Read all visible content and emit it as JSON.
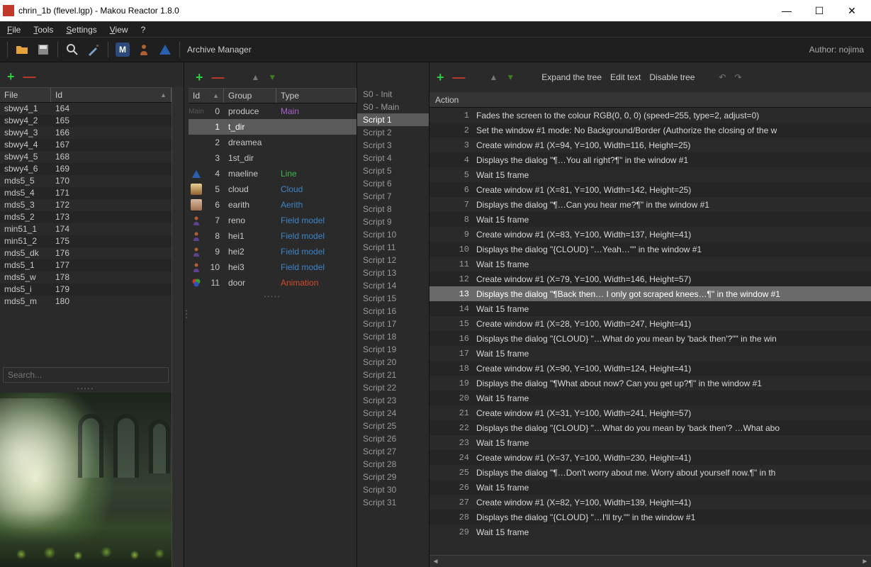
{
  "window": {
    "title": "chrin_1b (flevel.lgp) - Makou Reactor 1.8.0"
  },
  "menu": {
    "file": "File",
    "tools": "Tools",
    "settings": "Settings",
    "view": "View",
    "help": "?"
  },
  "toolbar": {
    "archive_manager": "Archive Manager",
    "author_label": "Author: nojima"
  },
  "actions_toolbar": {
    "expand": "Expand the tree",
    "edit": "Edit text",
    "disable": "Disable tree"
  },
  "files": {
    "header_file": "File",
    "header_id": "Id",
    "search_placeholder": "Search...",
    "rows": [
      {
        "file": "sbwy4_1",
        "id": "164"
      },
      {
        "file": "sbwy4_2",
        "id": "165"
      },
      {
        "file": "sbwy4_3",
        "id": "166"
      },
      {
        "file": "sbwy4_4",
        "id": "167"
      },
      {
        "file": "sbwy4_5",
        "id": "168"
      },
      {
        "file": "sbwy4_6",
        "id": "169"
      },
      {
        "file": "mds5_5",
        "id": "170"
      },
      {
        "file": "mds5_4",
        "id": "171"
      },
      {
        "file": "mds5_3",
        "id": "172"
      },
      {
        "file": "mds5_2",
        "id": "173"
      },
      {
        "file": "min51_1",
        "id": "174"
      },
      {
        "file": "min51_2",
        "id": "175"
      },
      {
        "file": "mds5_dk",
        "id": "176"
      },
      {
        "file": "mds5_1",
        "id": "177"
      },
      {
        "file": "mds5_w",
        "id": "178"
      },
      {
        "file": "mds5_i",
        "id": "179"
      },
      {
        "file": "mds5_m",
        "id": "180"
      }
    ]
  },
  "groups": {
    "header_id": "Id",
    "header_group": "Group",
    "header_type": "Type",
    "rows": [
      {
        "id": "0",
        "group": "produce",
        "type": "Main",
        "tclass": "tMain",
        "icon": "main",
        "sel": false
      },
      {
        "id": "1",
        "group": "t_dir",
        "type": "",
        "tclass": "",
        "icon": "",
        "sel": true
      },
      {
        "id": "2",
        "group": "dreamea",
        "type": "",
        "tclass": "",
        "icon": "",
        "sel": false
      },
      {
        "id": "3",
        "group": "1st_dir",
        "type": "",
        "tclass": "",
        "icon": "",
        "sel": false
      },
      {
        "id": "4",
        "group": "maeline",
        "type": "Line",
        "tclass": "tLine",
        "icon": "tri",
        "sel": false
      },
      {
        "id": "5",
        "group": "cloud",
        "type": "Cloud",
        "tclass": "tCloud",
        "icon": "av1",
        "sel": false
      },
      {
        "id": "6",
        "group": "earith",
        "type": "Aerith",
        "tclass": "tAerith",
        "icon": "av2",
        "sel": false
      },
      {
        "id": "7",
        "group": "reno",
        "type": "Field model",
        "tclass": "tFieldModel",
        "icon": "fm",
        "sel": false
      },
      {
        "id": "8",
        "group": "hei1",
        "type": "Field model",
        "tclass": "tFieldModel",
        "icon": "fm",
        "sel": false
      },
      {
        "id": "9",
        "group": "hei2",
        "type": "Field model",
        "tclass": "tFieldModel",
        "icon": "fm",
        "sel": false
      },
      {
        "id": "10",
        "group": "hei3",
        "type": "Field model",
        "tclass": "tFieldModel",
        "icon": "fm",
        "sel": false
      },
      {
        "id": "11",
        "group": "door",
        "type": "Animation",
        "tclass": "tAnimation",
        "icon": "anim",
        "sel": false
      }
    ]
  },
  "scripts": {
    "items": [
      {
        "label": "S0 - Init",
        "sel": false
      },
      {
        "label": "S0 - Main",
        "sel": false
      },
      {
        "label": "Script 1",
        "sel": true
      },
      {
        "label": "Script 2",
        "sel": false
      },
      {
        "label": "Script 3",
        "sel": false
      },
      {
        "label": "Script 4",
        "sel": false
      },
      {
        "label": "Script 5",
        "sel": false
      },
      {
        "label": "Script 6",
        "sel": false
      },
      {
        "label": "Script 7",
        "sel": false
      },
      {
        "label": "Script 8",
        "sel": false
      },
      {
        "label": "Script 9",
        "sel": false
      },
      {
        "label": "Script 10",
        "sel": false
      },
      {
        "label": "Script 11",
        "sel": false
      },
      {
        "label": "Script 12",
        "sel": false
      },
      {
        "label": "Script 13",
        "sel": false
      },
      {
        "label": "Script 14",
        "sel": false
      },
      {
        "label": "Script 15",
        "sel": false
      },
      {
        "label": "Script 16",
        "sel": false
      },
      {
        "label": "Script 17",
        "sel": false
      },
      {
        "label": "Script 18",
        "sel": false
      },
      {
        "label": "Script 19",
        "sel": false
      },
      {
        "label": "Script 20",
        "sel": false
      },
      {
        "label": "Script 21",
        "sel": false
      },
      {
        "label": "Script 22",
        "sel": false
      },
      {
        "label": "Script 23",
        "sel": false
      },
      {
        "label": "Script 24",
        "sel": false
      },
      {
        "label": "Script 25",
        "sel": false
      },
      {
        "label": "Script 26",
        "sel": false
      },
      {
        "label": "Script 27",
        "sel": false
      },
      {
        "label": "Script 28",
        "sel": false
      },
      {
        "label": "Script 29",
        "sel": false
      },
      {
        "label": "Script 30",
        "sel": false
      },
      {
        "label": "Script 31",
        "sel": false
      }
    ]
  },
  "actions": {
    "header": "Action",
    "rows": [
      {
        "n": 1,
        "t": "Fades the screen to the colour RGB(0, 0, 0) (speed=255, type=2, adjust=0)",
        "sel": false
      },
      {
        "n": 2,
        "t": "Set the window #1 mode: No Background/Border (Authorize the closing of the w",
        "sel": false
      },
      {
        "n": 3,
        "t": "Create window #1 (X=94, Y=100, Width=116, Height=25)",
        "sel": false
      },
      {
        "n": 4,
        "t": "Displays the dialog \"¶…You all right?¶\" in the window #1",
        "sel": false
      },
      {
        "n": 5,
        "t": "Wait 15 frame",
        "sel": false
      },
      {
        "n": 6,
        "t": "Create window #1 (X=81, Y=100, Width=142, Height=25)",
        "sel": false
      },
      {
        "n": 7,
        "t": "Displays the dialog \"¶…Can you hear me?¶\" in the window #1",
        "sel": false
      },
      {
        "n": 8,
        "t": "Wait 15 frame",
        "sel": false
      },
      {
        "n": 9,
        "t": "Create window #1 (X=83, Y=100, Width=137, Height=41)",
        "sel": false
      },
      {
        "n": 10,
        "t": "Displays the dialog \"{CLOUD} \"…Yeah…\"\" in the window #1",
        "sel": false
      },
      {
        "n": 11,
        "t": "Wait 15 frame",
        "sel": false
      },
      {
        "n": 12,
        "t": "Create window #1 (X=79, Y=100, Width=146, Height=57)",
        "sel": false
      },
      {
        "n": 13,
        "t": "Displays the dialog \"¶Back then… I only got scraped knees…¶\" in the window #1",
        "sel": true
      },
      {
        "n": 14,
        "t": "Wait 15 frame",
        "sel": false
      },
      {
        "n": 15,
        "t": "Create window #1 (X=28, Y=100, Width=247, Height=41)",
        "sel": false
      },
      {
        "n": 16,
        "t": "Displays the dialog \"{CLOUD} \"…What do you mean by 'back then'?\"\" in the win",
        "sel": false
      },
      {
        "n": 17,
        "t": "Wait 15 frame",
        "sel": false
      },
      {
        "n": 18,
        "t": "Create window #1 (X=90, Y=100, Width=124, Height=41)",
        "sel": false
      },
      {
        "n": 19,
        "t": "Displays the dialog \"¶What about now? Can you get up?¶\" in the window #1",
        "sel": false
      },
      {
        "n": 20,
        "t": "Wait 15 frame",
        "sel": false
      },
      {
        "n": 21,
        "t": "Create window #1 (X=31, Y=100, Width=241, Height=57)",
        "sel": false
      },
      {
        "n": 22,
        "t": "Displays the dialog \"{CLOUD} \"…What do you mean by 'back then'? …What abo",
        "sel": false
      },
      {
        "n": 23,
        "t": "Wait 15 frame",
        "sel": false
      },
      {
        "n": 24,
        "t": "Create window #1 (X=37, Y=100, Width=230, Height=41)",
        "sel": false
      },
      {
        "n": 25,
        "t": "Displays the dialog \"¶…Don't worry about me. Worry about yourself now.¶\" in th",
        "sel": false
      },
      {
        "n": 26,
        "t": "Wait 15 frame",
        "sel": false
      },
      {
        "n": 27,
        "t": "Create window #1 (X=82, Y=100, Width=139, Height=41)",
        "sel": false
      },
      {
        "n": 28,
        "t": "Displays the dialog \"{CLOUD} \"…I'll try.\"\" in the window #1",
        "sel": false
      },
      {
        "n": 29,
        "t": "Wait 15 frame",
        "sel": false
      }
    ]
  }
}
